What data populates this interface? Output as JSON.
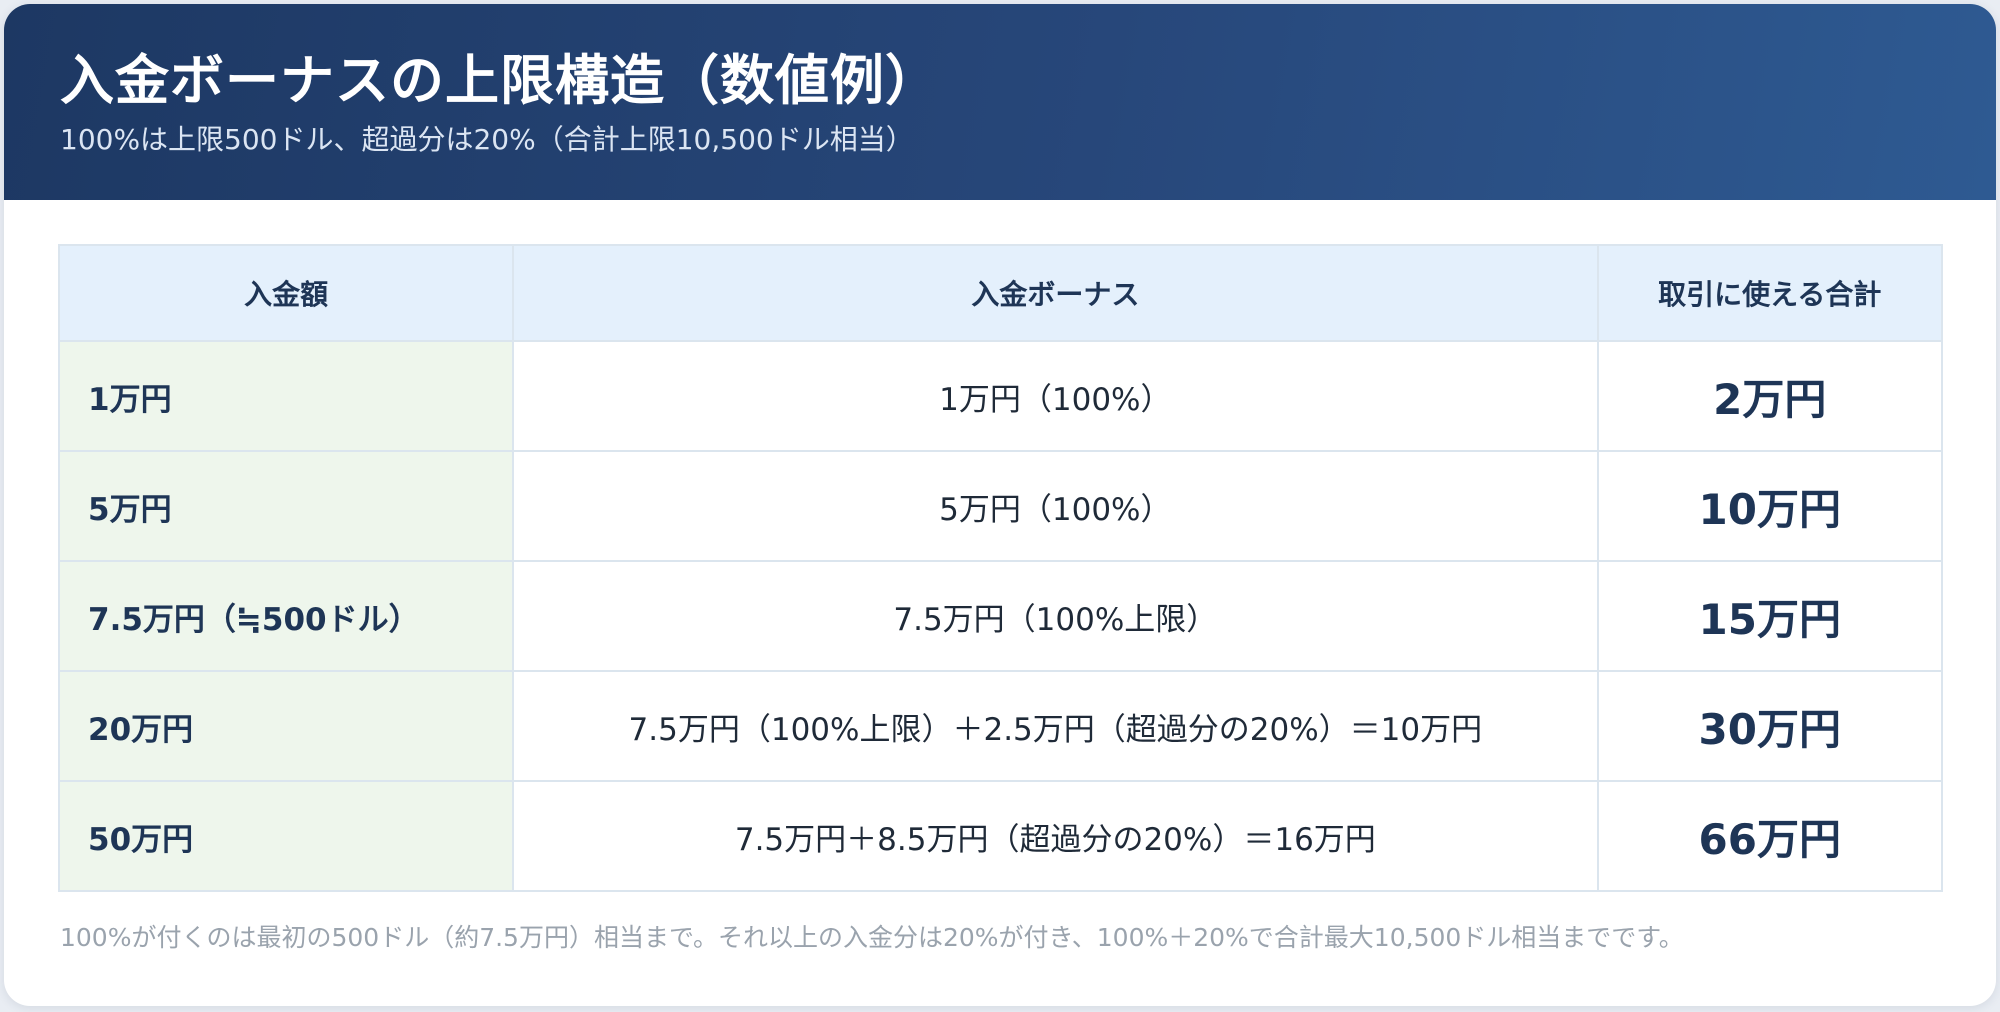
{
  "header": {
    "title": "入金ボーナスの上限構造（数値例）",
    "subtitle": "100%は上限500ドル、超過分は20%（合計上限10,500ドル相当）"
  },
  "table": {
    "columns": [
      "入金額",
      "入金ボーナス",
      "取引に使える合計"
    ],
    "rows": [
      {
        "deposit": "1万円",
        "bonus": "1万円（100%）",
        "total": "2万円"
      },
      {
        "deposit": "5万円",
        "bonus": "5万円（100%）",
        "total": "10万円"
      },
      {
        "deposit": "7.5万円（≒500ドル）",
        "bonus": "7.5万円（100%上限）",
        "total": "15万円"
      },
      {
        "deposit": "20万円",
        "bonus": "7.5万円（100%上限）＋2.5万円（超過分の20%）＝10万円",
        "total": "30万円"
      },
      {
        "deposit": "50万円",
        "bonus": "7.5万円＋8.5万円（超過分の20%）＝16万円",
        "total": "66万円"
      }
    ]
  },
  "note": "100%が付くのは最初の500ドル（約7.5万円）相当まで。それ以上の入金分は20%が付き、100%＋20%で合計最大10,500ドル相当までです。",
  "colors": {
    "header_bg": "#1d3863",
    "header_bg_end": "#2e5a92",
    "table_header_bg": "#e4f0fc",
    "deposit_column_bg": "#eef6ec",
    "text_dark": "#1e3556",
    "note_text": "#9aa3ad"
  }
}
